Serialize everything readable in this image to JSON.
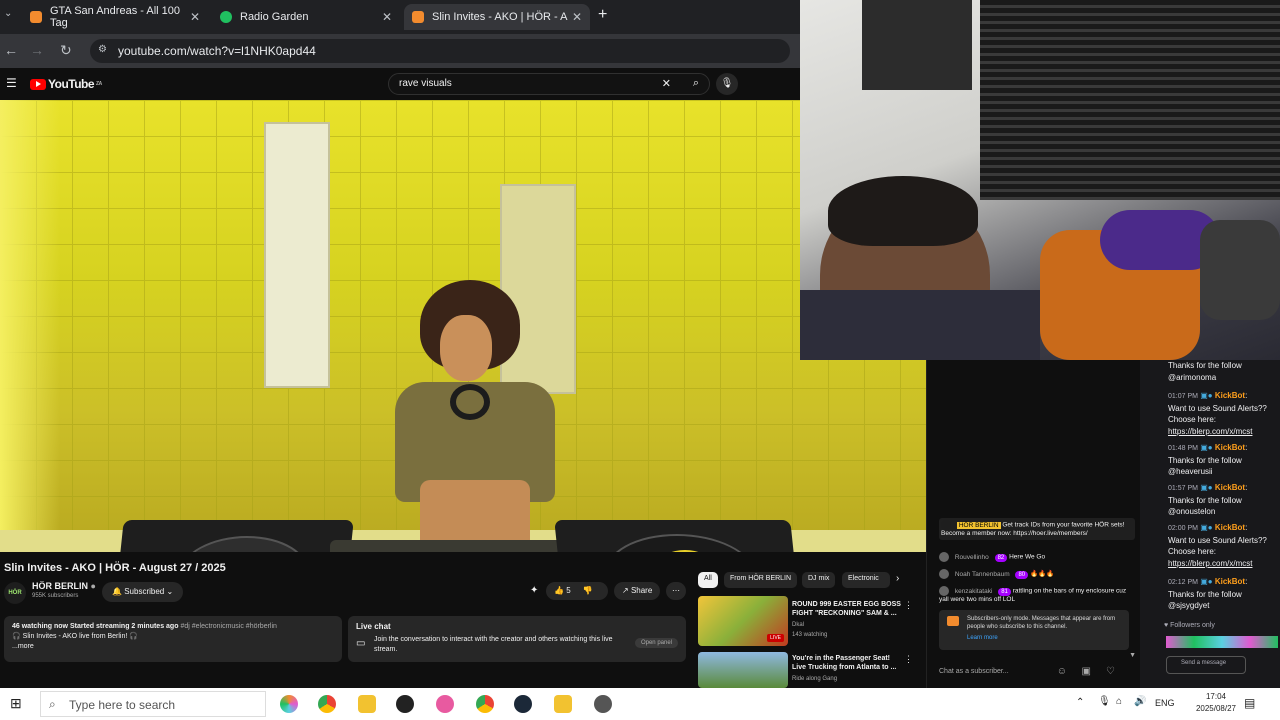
{
  "browser": {
    "tabs": [
      {
        "title": "GTA San Andreas - All 100 Tag",
        "favicon_color": "#f28b2e"
      },
      {
        "title": "Radio Garden",
        "favicon_color": "#20c060"
      },
      {
        "title": "Slin Invites - AKO | HÖR - A",
        "favicon_color": "#f28b2e"
      }
    ],
    "url": "youtube.com/watch?v=l1NHK0apd44",
    "new_tab_icon": "plus-icon"
  },
  "youtube": {
    "logo_text": "YouTube",
    "logo_region": "ZA",
    "search_query": "rave visuals",
    "video": {
      "title": "Slin Invites - AKO | HÖR - August 27 / 2025",
      "channel": {
        "name": "HÖR BERLIN",
        "avatar_text": "HÖR",
        "subscribers": "955K subscribers"
      },
      "subscribe_label": "Subscribed",
      "likes": "5",
      "share_label": "Share",
      "description": {
        "stats": "46 watching now  Started streaming 2 minutes ago",
        "tags": "#dj #electronicmusic #hörberlin",
        "line2": "🎧 Slin Invites - AKO live from Berlin! 🎧",
        "more": "...more"
      },
      "livechat_card": {
        "title": "Live chat",
        "text": "Join the conversation to interact with the creator and others watching this live stream.",
        "button": "Open panel"
      }
    },
    "rec_chips": [
      "All",
      "From HÖR BERLIN",
      "DJ mix",
      "Electronic"
    ],
    "recommendations": [
      {
        "title": "ROUND 999 EASTER EGG BOSS FIGHT \"RECKONING\" SAM & ...",
        "channel": "Dkal",
        "meta": "143 watching",
        "badge": "LIVE"
      },
      {
        "title": "You're in the Passenger Seat! Live Trucking from Atlanta to ...",
        "channel": "Ride along Gang",
        "meta": ""
      }
    ],
    "chat": {
      "messages": [
        {
          "author": "HÖR BERLIN",
          "text": "Get track IDs from your favorite HÖR sets! Become a member now: https://hoer.live/members/",
          "highlight": true
        },
        {
          "author": "Rouvellinho",
          "badge": "82",
          "text": "Here We Go"
        },
        {
          "author": "Noah Tannenbaum",
          "badge": "80",
          "text": "🔥🔥🔥"
        },
        {
          "author": "kenzakitataki",
          "badge": "81",
          "text": "rattling on the bars of my enclosure cuz yall were two mins off LOL"
        }
      ],
      "subscribers_only_text": "Subscribers-only mode. Messages that appear are from people who subscribe to this channel.",
      "learn_more": "Learn more",
      "input_placeholder": "Chat as a subscriber..."
    }
  },
  "twitch_chat": {
    "first_line": "Thanks for the follow",
    "first_user": "@arimonoma",
    "messages": [
      {
        "time": "01:07 PM",
        "bot": "KickBot",
        "lines": [
          "Want to use Sound Alerts?? Choose here:"
        ],
        "link": "https://blerp.com/x/mcst"
      },
      {
        "time": "01:48 PM",
        "bot": "KickBot",
        "lines": [
          "Thanks for the follow",
          "@heaverusii"
        ],
        "link": ""
      },
      {
        "time": "01:57 PM",
        "bot": "KickBot",
        "lines": [
          "Thanks for the follow",
          "@onoustelon"
        ],
        "link": ""
      },
      {
        "time": "02:00 PM",
        "bot": "KickBot",
        "lines": [
          "Want to use Sound Alerts?? Choose here:"
        ],
        "link": "https://blerp.com/x/mcst"
      },
      {
        "time": "02:12 PM",
        "bot": "KickBot",
        "lines": [
          "Thanks for the follow",
          "@sjsygdyet"
        ],
        "link": ""
      }
    ],
    "followers_only": "Followers only",
    "send_label": "Send a message"
  },
  "taskbar": {
    "search_placeholder": "Type here to search",
    "lang": "ENG",
    "time": "17:04",
    "date": "2025/08/27"
  }
}
